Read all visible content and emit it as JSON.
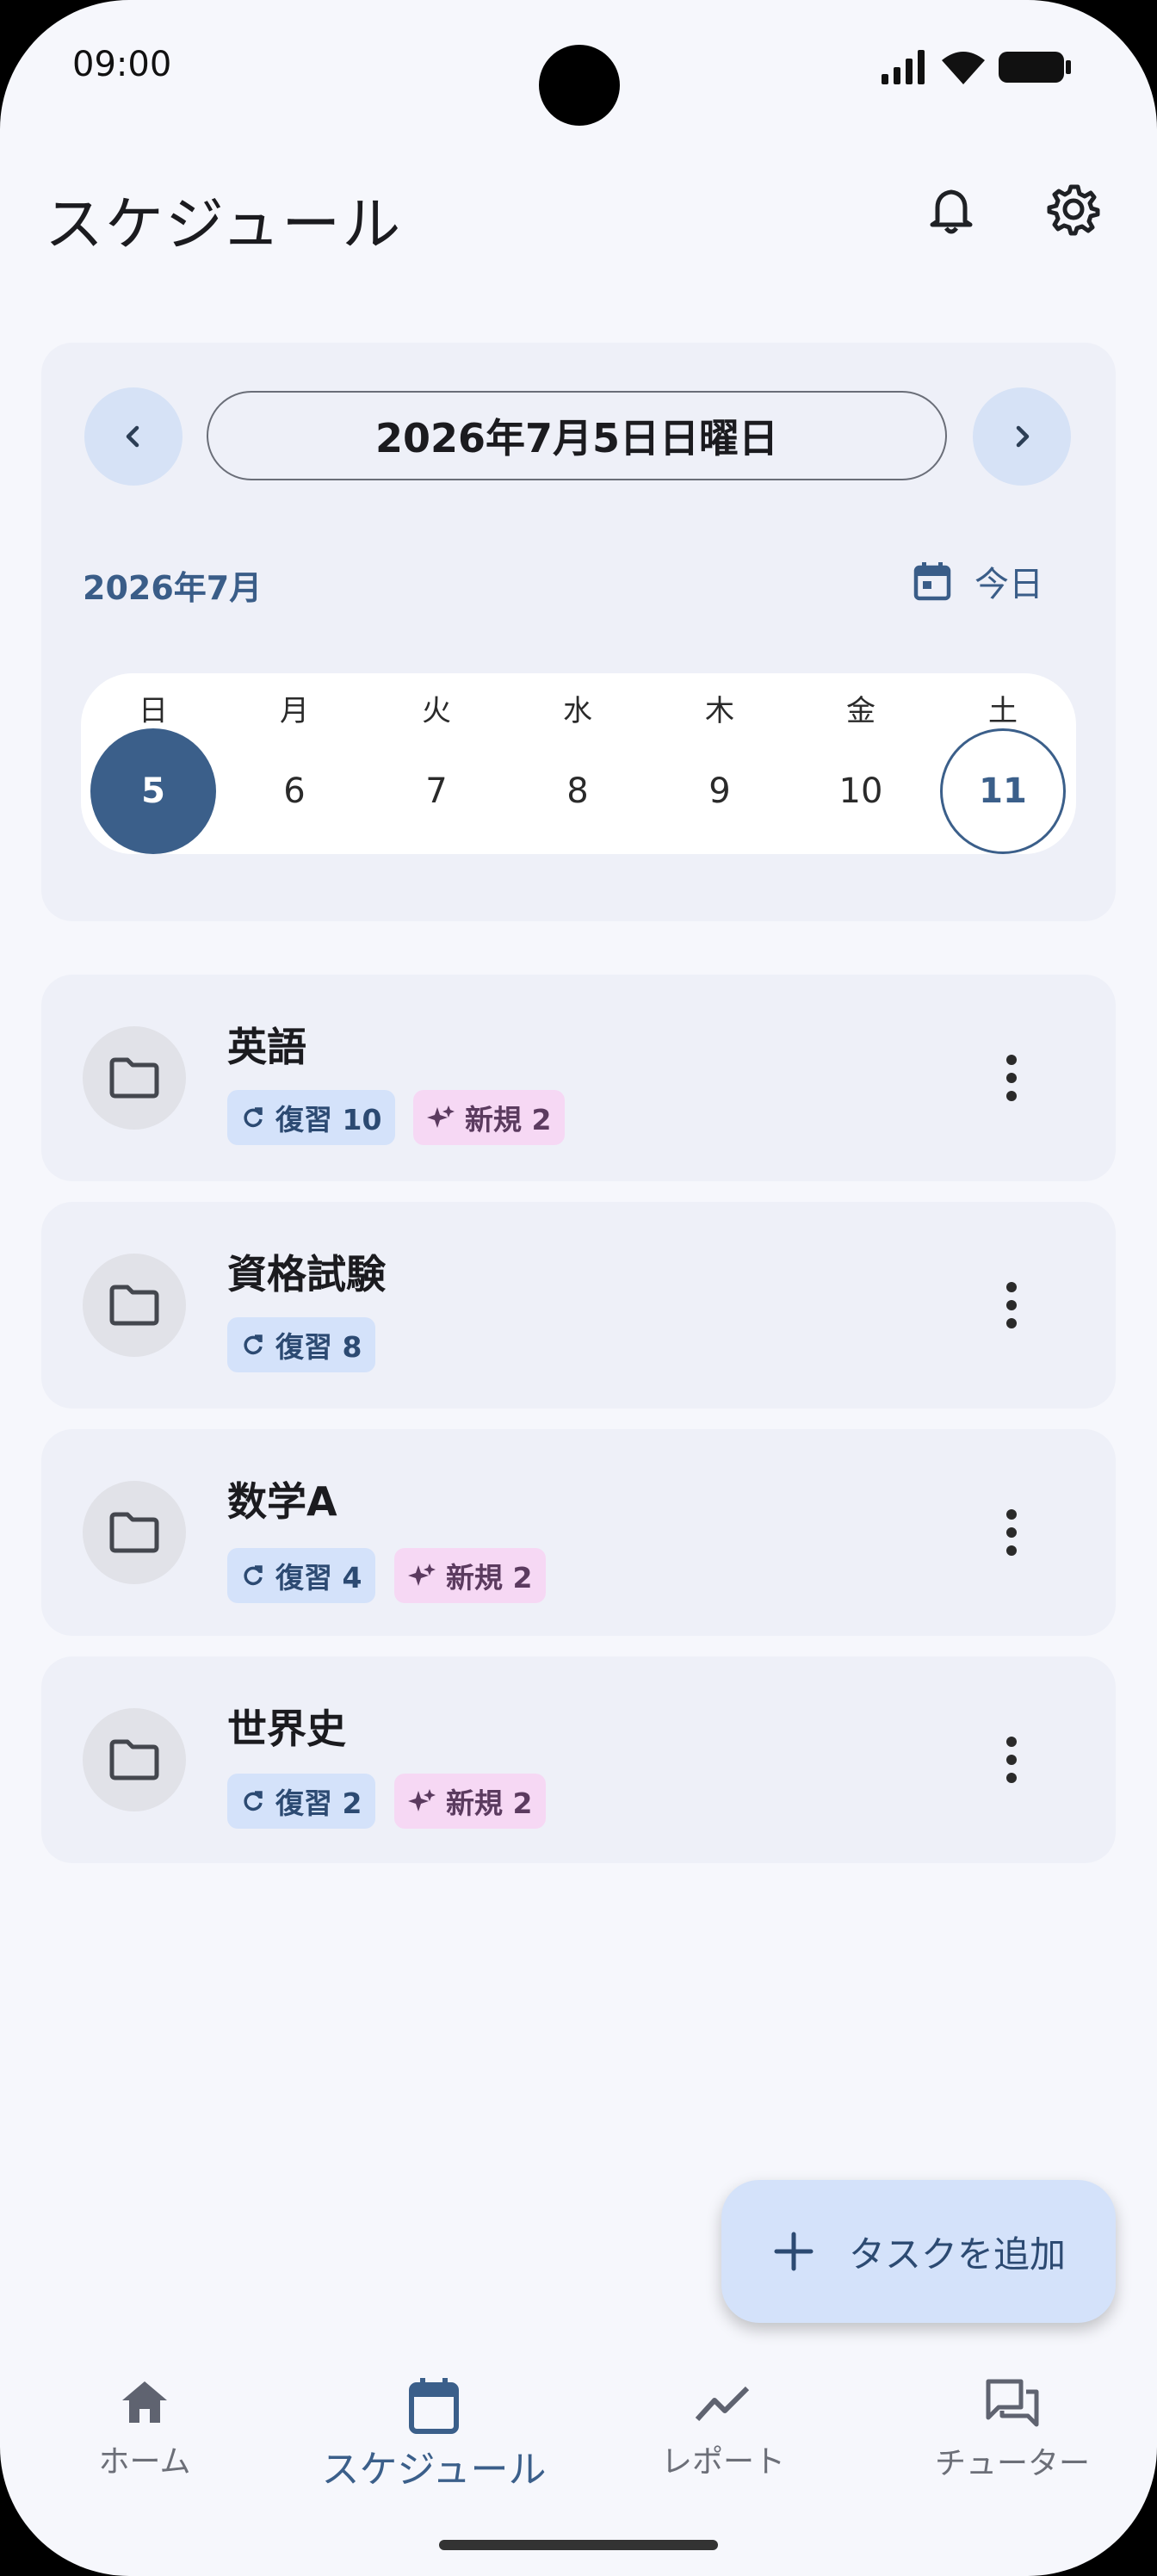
{
  "status_bar": {
    "time": "09:00"
  },
  "header": {
    "title": "スケジュール"
  },
  "calendar": {
    "selected_date": "2026年7月5日日曜日",
    "month": "2026年7月",
    "today_label": "今日",
    "weekdays": [
      "日",
      "月",
      "火",
      "水",
      "木",
      "金",
      "土"
    ],
    "days": [
      "5",
      "6",
      "7",
      "8",
      "9",
      "10",
      "11"
    ]
  },
  "tasks": [
    {
      "title": "英語",
      "review": "復習 10",
      "new": "新規 2"
    },
    {
      "title": "資格試験",
      "review": "復習 8"
    },
    {
      "title": "数学A",
      "review": "復習 4",
      "new": "新規 2"
    },
    {
      "title": "世界史",
      "review": "復習 2",
      "new": "新規 2"
    }
  ],
  "fab": {
    "label": "タスクを追加"
  },
  "nav": [
    {
      "label": "ホーム"
    },
    {
      "label": "スケジュール"
    },
    {
      "label": "レポート"
    },
    {
      "label": "チューター"
    }
  ],
  "colors": {
    "primary": "#3b5f8a",
    "background": "#f6f7fc",
    "card": "#eef0f8",
    "review_chip": "#d4e2fa",
    "new_chip": "#f6d8f4"
  }
}
